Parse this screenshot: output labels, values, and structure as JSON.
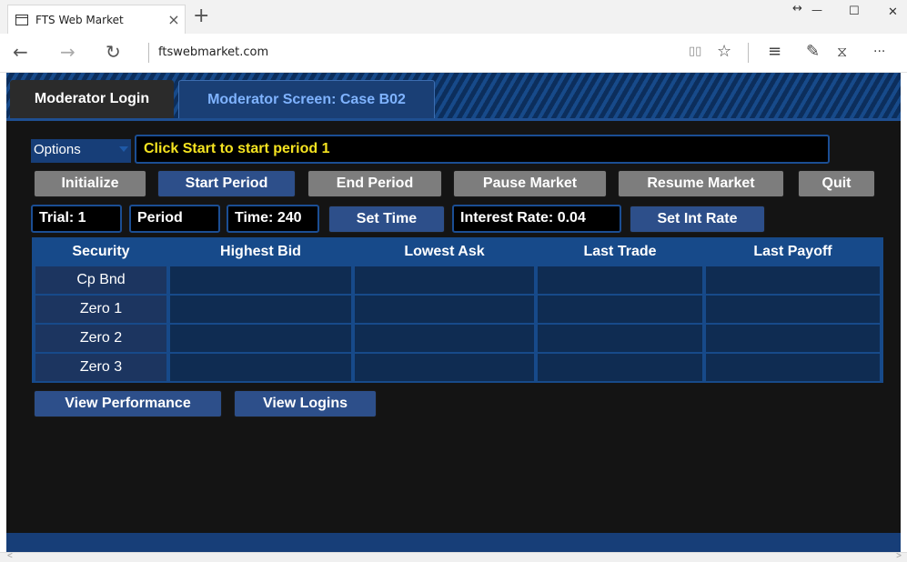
{
  "browser": {
    "tab_title": "FTS Web Market",
    "tab_close": "×",
    "new_tab": "+",
    "url": "ftswebmarket.com",
    "nav": {
      "back": "←",
      "forward": "→",
      "refresh": "↻"
    },
    "tools": {
      "reading_view": "▯▯",
      "favorite": "☆",
      "hub": "≡",
      "note": "✎",
      "share": "⧖",
      "more": "···"
    },
    "window": {
      "restore": "↔",
      "minimize": "—",
      "maximize": "☐",
      "close": "✕"
    }
  },
  "app": {
    "tabs": {
      "login": "Moderator Login",
      "screen": "Moderator Screen: Case B02"
    },
    "options_label": "Options",
    "message": "Click Start to start period 1",
    "buttons": {
      "initialize": "Initialize",
      "start_period": "Start Period",
      "end_period": "End Period",
      "pause_market": "Pause Market",
      "resume_market": "Resume Market",
      "quit": "Quit",
      "set_time": "Set Time",
      "set_int_rate": "Set Int Rate",
      "view_performance": "View Performance",
      "view_logins": "View Logins"
    },
    "fields": {
      "trial": "Trial: 1",
      "period": "Period",
      "time": "Time: 240",
      "interest_rate": "Interest Rate: 0.04"
    },
    "table": {
      "headers": [
        "Security",
        "Highest Bid",
        "Lowest Ask",
        "Last Trade",
        "Last Payoff"
      ],
      "rows": [
        {
          "security": "Cp Bnd",
          "highest_bid": "",
          "lowest_ask": "",
          "last_trade": "",
          "last_payoff": ""
        },
        {
          "security": "Zero 1",
          "highest_bid": "",
          "lowest_ask": "",
          "last_trade": "",
          "last_payoff": ""
        },
        {
          "security": "Zero 2",
          "highest_bid": "",
          "lowest_ask": "",
          "last_trade": "",
          "last_payoff": ""
        },
        {
          "security": "Zero 3",
          "highest_bid": "",
          "lowest_ask": "",
          "last_trade": "",
          "last_payoff": ""
        }
      ]
    }
  },
  "colors": {
    "accent_blue": "#174a8a",
    "message_yellow": "#f5e320",
    "page_bg": "#141414"
  }
}
